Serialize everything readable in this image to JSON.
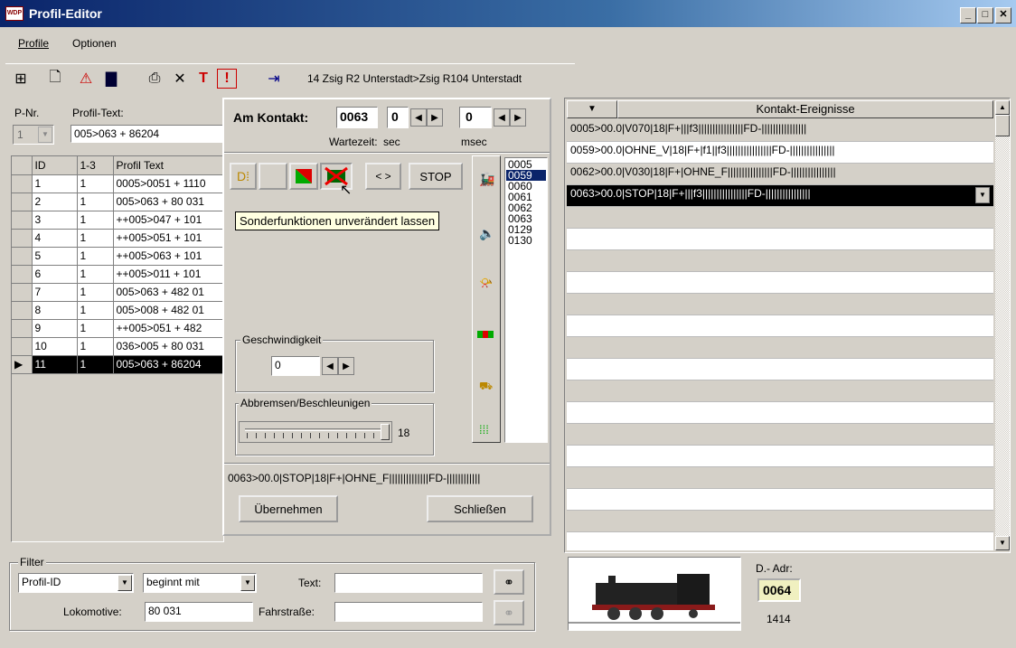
{
  "window": {
    "title": "Profil-Editor",
    "icon_text": "WDP"
  },
  "menu": [
    {
      "label": "Profile"
    },
    {
      "label": "Optionen"
    }
  ],
  "toolbar": {
    "route_text": "14 Zsig R2 Unterstadt>Zsig R104 Unterstadt"
  },
  "left": {
    "pnr_label": "P-Nr.",
    "pnr_value": "1",
    "profiltext_label": "Profil-Text:",
    "profiltext_value": "005>063 + 86204",
    "columns": [
      "ID",
      "1-3",
      "Profil Text"
    ],
    "rows": [
      {
        "id": "1",
        "c": "1",
        "text": "0005>0051 + 1110"
      },
      {
        "id": "2",
        "c": "1",
        "text": "005>063 + 80 031"
      },
      {
        "id": "3",
        "c": "1",
        "text": "++005>047 + 101"
      },
      {
        "id": "4",
        "c": "1",
        "text": "++005>051 + 101"
      },
      {
        "id": "5",
        "c": "1",
        "text": "++005>063 + 101"
      },
      {
        "id": "6",
        "c": "1",
        "text": "++005>011 + 101"
      },
      {
        "id": "7",
        "c": "1",
        "text": "005>063 + 482 01"
      },
      {
        "id": "8",
        "c": "1",
        "text": "005>008 + 482 01"
      },
      {
        "id": "9",
        "c": "1",
        "text": "++005>051 + 482"
      },
      {
        "id": "10",
        "c": "1",
        "text": "036>005 + 80 031"
      },
      {
        "id": "11",
        "c": "1",
        "text": "005>063 + 86204"
      }
    ]
  },
  "dialog": {
    "kontakt_label": "Am Kontakt:",
    "kontakt_value": "0063",
    "sec_value": "0",
    "msec_value": "0",
    "wartezeit_label": "Wartezeit:",
    "sec_label": "sec",
    "msec_label": "msec",
    "arrows_label": "< >",
    "stop_label": "STOP",
    "tooltip": "Sonderfunktionen unverändert lassen",
    "contact_list": [
      "0005",
      "0059",
      "0060",
      "0061",
      "0062",
      "0063",
      "0129",
      "0130"
    ],
    "contact_selected": "0059",
    "speed_group": "Geschwindigkeit",
    "speed_value": "0",
    "brake_group": "Abbremsen/Beschleunigen",
    "brake_value": "18",
    "brake_fraction": 1.0,
    "summary": "0063>00.0|STOP|18|F+|OHNE_F||||||||||||||FD-||||||||||||",
    "apply_button": "Übernehmen",
    "close_button": "Schließen"
  },
  "events": {
    "header": "Kontakt-Ereignisse",
    "rows": [
      "0005>00.0|V070|18|F+|||f3||||||||||||||||FD-||||||||||||||||",
      "0059>00.0|OHNE_V|18|F+|f1||f3||||||||||||||||FD-||||||||||||||||",
      "0062>00.0|V030|18|F+|OHNE_F||||||||||||||||FD-||||||||||||||||",
      "0063>00.0|STOP|18|F+|||f3||||||||||||||||FD-||||||||||||||||"
    ],
    "selected_index": 3,
    "empty_rows": 15
  },
  "filter": {
    "group": "Filter",
    "field_select": "Profil-ID",
    "op_select": "beginnt mit",
    "text_label": "Text:",
    "text_value": "",
    "loco_label": "Lokomotive:",
    "loco_value": "80 031",
    "route_label": "Fahrstraße:",
    "route_value": ""
  },
  "loco": {
    "dadr_label": "D.- Adr:",
    "dadr_value": "0064",
    "number": "1414"
  }
}
